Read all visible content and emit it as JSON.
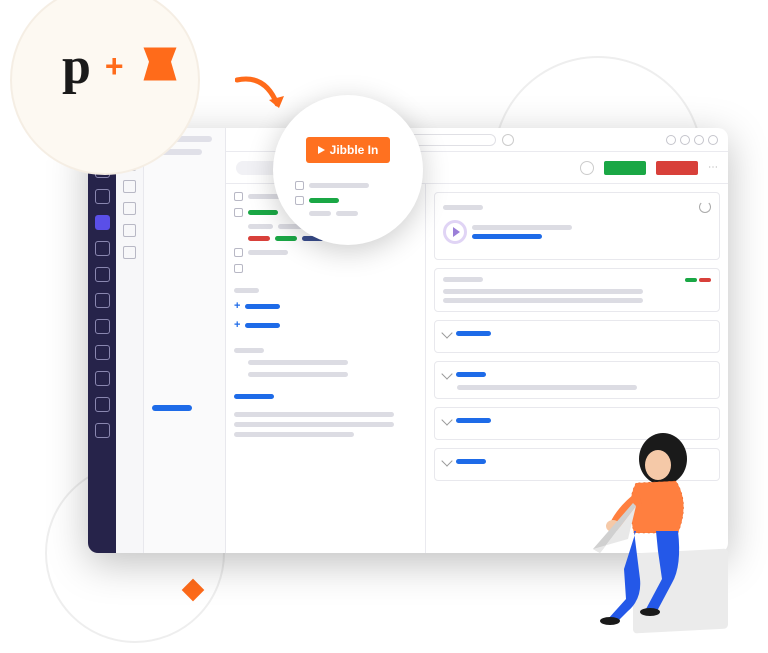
{
  "integration": {
    "app1_glyph": "p",
    "plus": "+",
    "button_label": "Jibble In"
  },
  "colors": {
    "orange": "#ff7120",
    "sidebar": "#26234a",
    "blue": "#1e6be8",
    "green": "#1aa745",
    "red": "#d8403a"
  }
}
